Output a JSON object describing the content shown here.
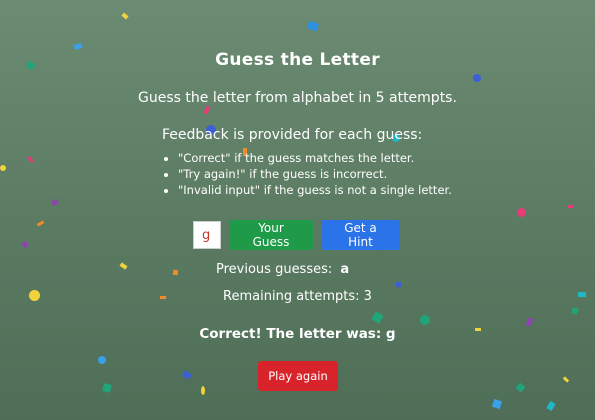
{
  "game": {
    "title": "Guess the Letter",
    "instructions": "Guess the letter from alphabet in 5 attempts.",
    "feedback_intro": "Feedback is provided for each guess:",
    "feedback_rules": [
      "\"Correct\" if the guess matches the letter.",
      "\"Try again!\" if the guess is incorrect.",
      "\"Invalid input\" if the guess is not a single letter."
    ]
  },
  "controls": {
    "guess_value": "g",
    "guess_button": "Your Guess",
    "hint_button": "Get a Hint"
  },
  "status": {
    "previous_guesses_label": "Previous guesses:",
    "previous_guesses_value": "a",
    "remaining_attempts": "Remaining attempts: 3",
    "result": "Correct! The letter was: g"
  },
  "play_again_button": "Play again",
  "colors": {
    "background": "#5f7f66",
    "guess_button": "#1f9a49",
    "hint_button": "#2b73e8",
    "play_again_button": "#d8232a",
    "input_text": "#c0392b"
  },
  "decorations": {
    "confetti": "multicolored confetti pieces"
  }
}
